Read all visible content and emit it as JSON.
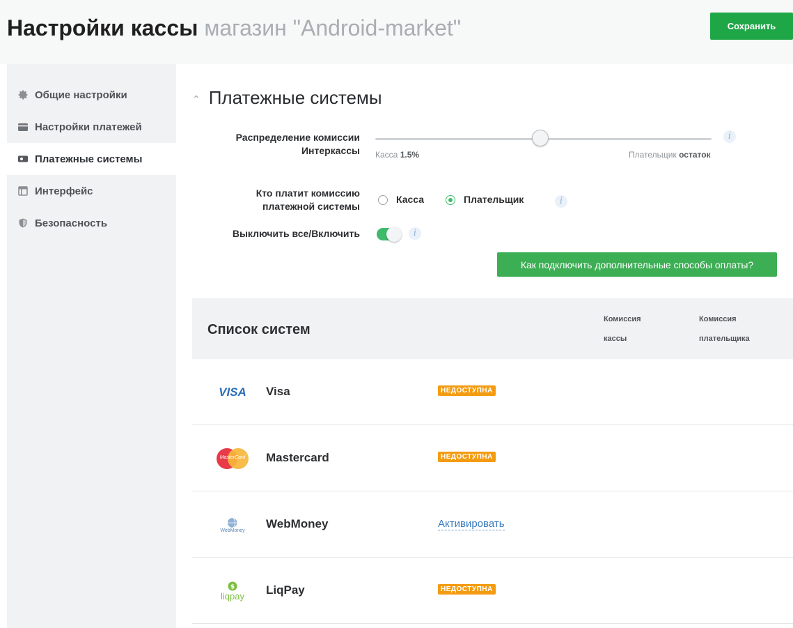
{
  "header": {
    "title": "Настройки кассы",
    "subtitle": "магазин \"Android-market\"",
    "save_label": "Сохранить"
  },
  "sidebar": {
    "items": [
      {
        "label": "Общие настройки",
        "icon": "gear-icon",
        "active": false
      },
      {
        "label": "Настройки платежей",
        "icon": "payment-card-icon",
        "active": false
      },
      {
        "label": "Платежные системы",
        "icon": "cash-icon",
        "active": true
      },
      {
        "label": "Интерфейс",
        "icon": "window-icon",
        "active": false
      },
      {
        "label": "Безопасность",
        "icon": "shield-icon",
        "active": false
      }
    ]
  },
  "section": {
    "title": "Платежные системы",
    "commission": {
      "label_line1": "Распределение комиссии",
      "label_line2": "Интеркассы",
      "left_caption": "Касса",
      "left_value": "1.5%",
      "right_caption": "Плательщик",
      "right_value": "остаток",
      "slider_fraction": 0.49
    },
    "payer": {
      "label_line1": "Кто платит комиссию",
      "label_line2": "платежной системы",
      "options": [
        "Касса",
        "Плательщик"
      ],
      "selected": "Плательщик"
    },
    "toggle": {
      "label": "Выключить все/Включить",
      "on": true
    },
    "howto_label": "Как подключить дополнительные способы оплаты?",
    "info_glyph": "i"
  },
  "systems_list": {
    "title": "Список систем",
    "col_cashbox": [
      "Комиссия",
      "кассы"
    ],
    "col_payer": [
      "Комиссия",
      "плательщика"
    ],
    "rows": [
      {
        "name": "Visa",
        "logo_text": "VISA",
        "status": "НЕДОСТУПНА",
        "action": null
      },
      {
        "name": "Mastercard",
        "logo_text": "MasterCard",
        "status": "НЕДОСТУПНА",
        "action": null
      },
      {
        "name": "WebMoney",
        "logo_text": "WebMoney",
        "status": null,
        "action": "Активировать"
      },
      {
        "name": "LiqPay",
        "logo_text": "liqpay",
        "status": "НЕДОСТУПНА",
        "action": null
      }
    ]
  },
  "colors": {
    "accent_green": "#1fa647",
    "badge_orange": "#f39c12",
    "link_blue": "#3a7bbd"
  }
}
